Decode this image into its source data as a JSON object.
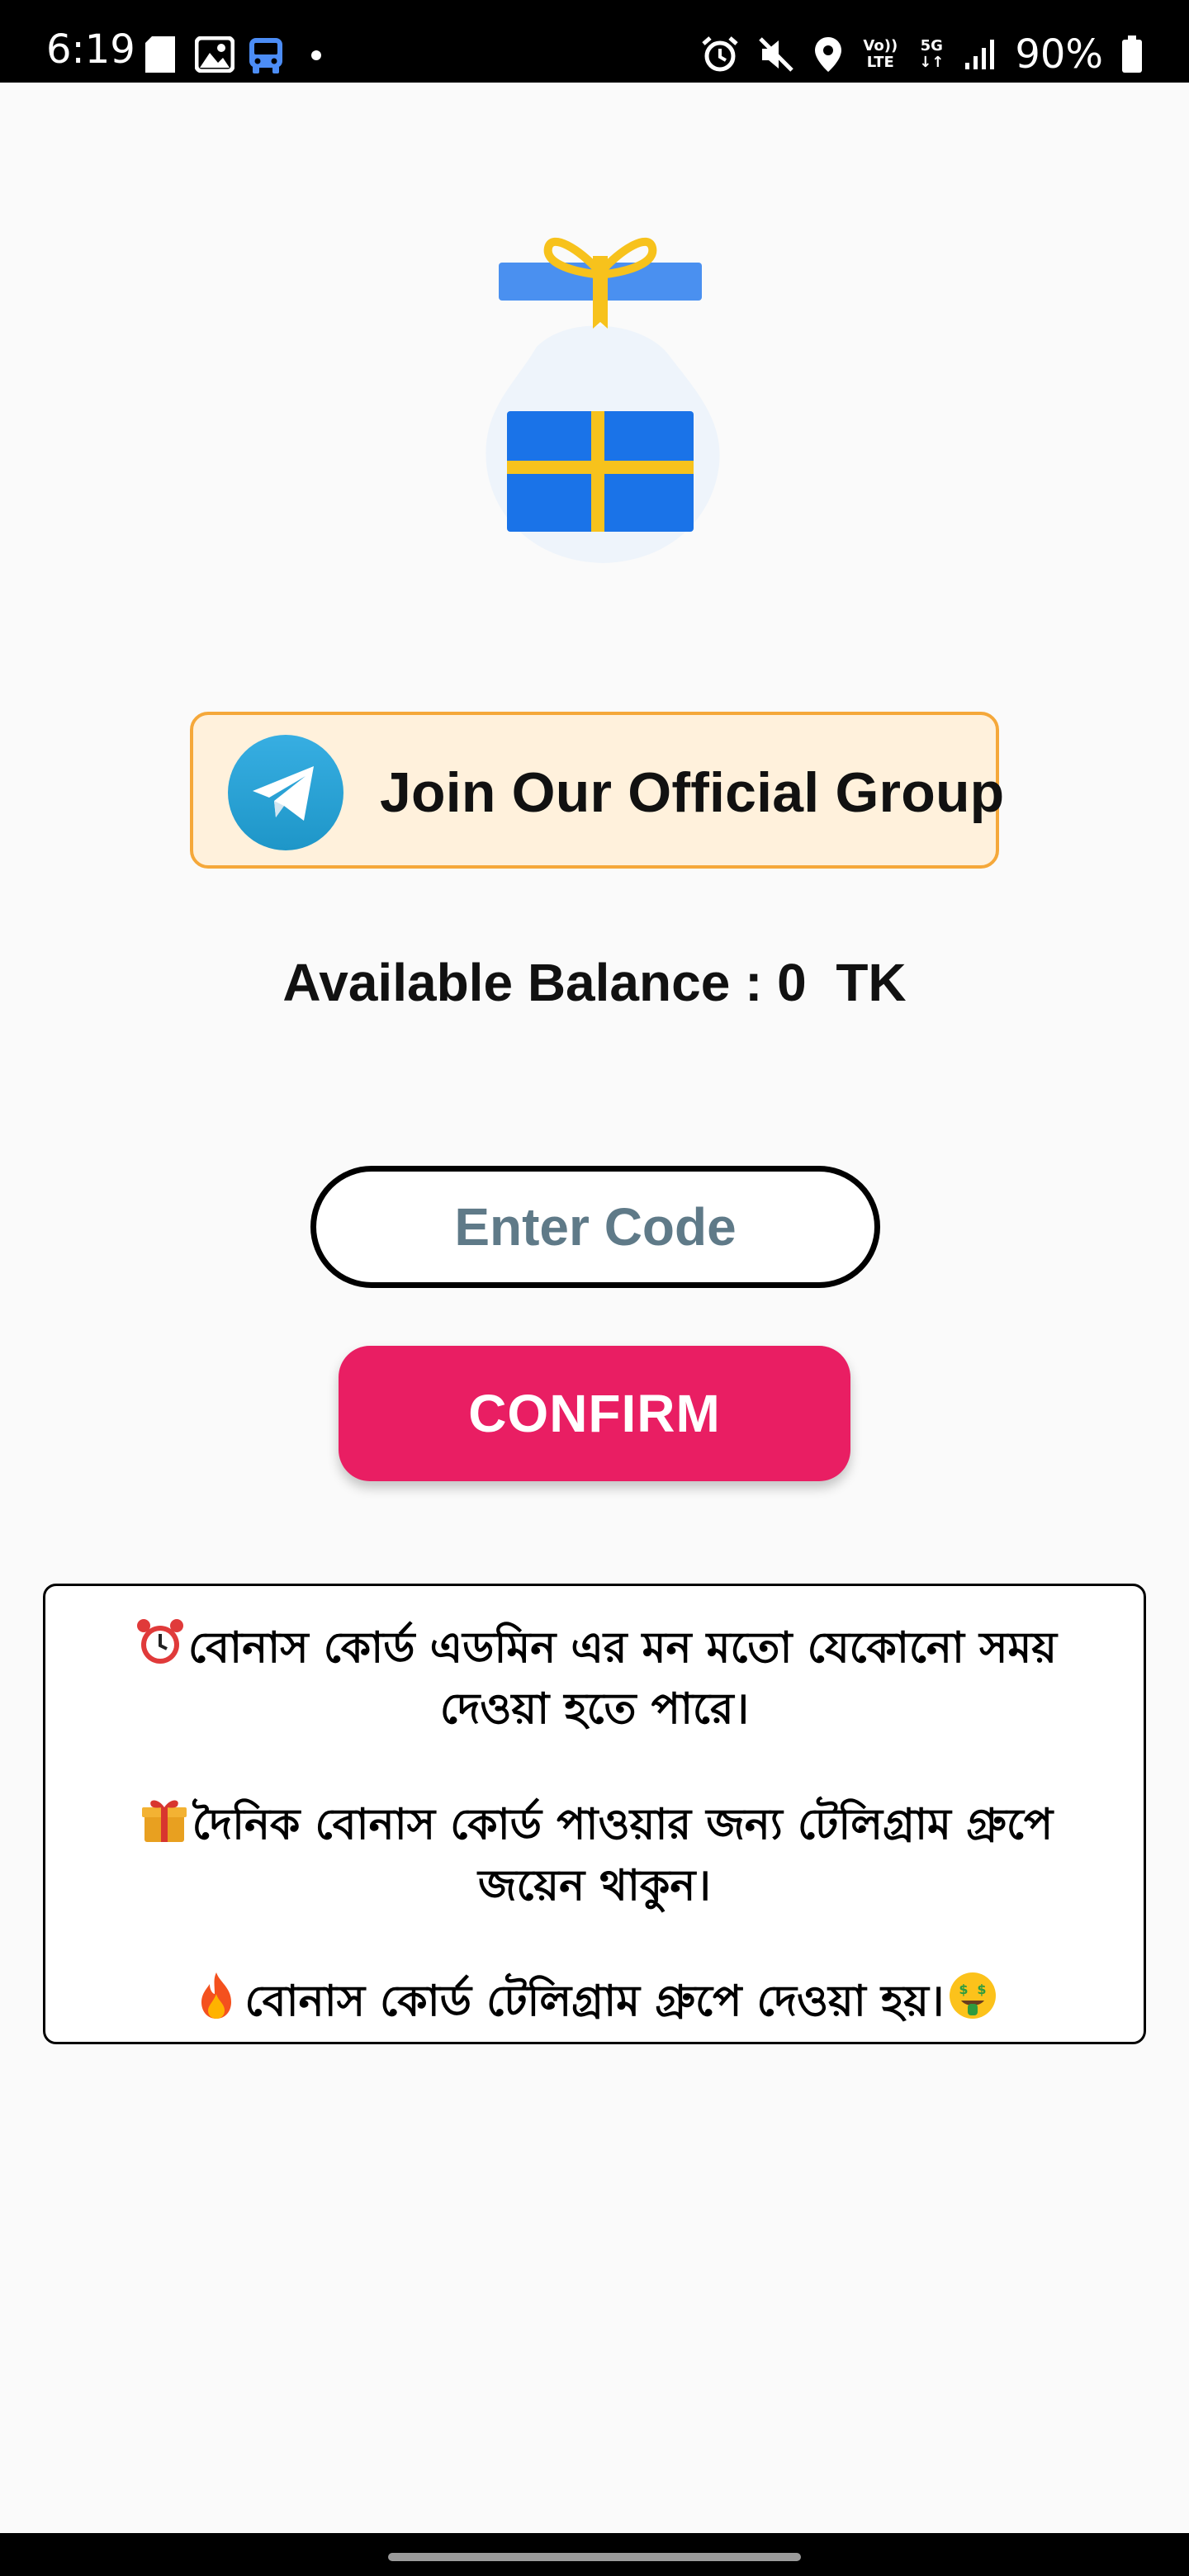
{
  "status_bar": {
    "time": "6:19",
    "battery": "90%",
    "network_top": "Vo))",
    "network_bottom": "LTE",
    "signal_label": "5G",
    "left_icons": [
      "sd-card-icon",
      "image-icon",
      "bus-icon",
      "dot-icon"
    ],
    "right_icons": [
      "alarm-icon",
      "mute-icon",
      "location-icon",
      "volte-icon",
      "5g-icon",
      "signal-icon",
      "battery-icon"
    ]
  },
  "gift": {
    "icon": "gift-icon",
    "box_color": "#1a73e8",
    "ribbon_color": "#f7c21c"
  },
  "join_banner": {
    "label": "Join Our Official Group",
    "icon": "telegram-icon",
    "background": "#fff1dc",
    "border_color": "#f5a83a"
  },
  "balance": {
    "text": "Available Balance : 0  TK"
  },
  "code_input": {
    "placeholder": "Enter Code",
    "value": ""
  },
  "confirm_button": {
    "label": "CONFIRM",
    "color": "#e91e63"
  },
  "notices": [
    {
      "icon": "alarm-clock-icon",
      "lines": [
        "বোনাস কোর্ড এডমিন এর মন মতো যেকোনো সময়",
        "দেওয়া হতে পারে।"
      ]
    },
    {
      "icon": "gift-emoji-icon",
      "lines": [
        "দৈনিক বোনাস কোর্ড পাওয়ার জন্য টেলিগ্রাম গ্রুপে",
        "জয়েন থাকুন।"
      ]
    },
    {
      "icon": "fire-icon",
      "trailing_icon": "money-face-icon",
      "lines": [
        "বোনাস কোর্ড টেলিগ্রাম গ্রুপে দেওয়া হয়।"
      ]
    }
  ]
}
